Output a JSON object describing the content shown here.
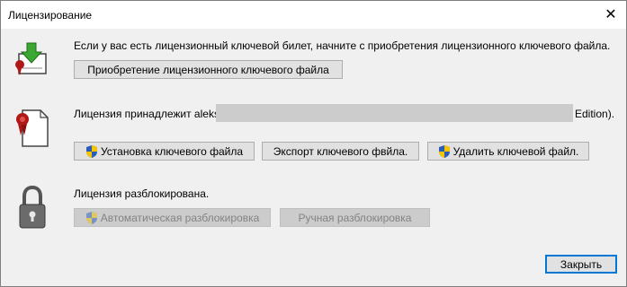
{
  "window": {
    "title": "Лицензирование",
    "close_glyph": "✕"
  },
  "purchase": {
    "text": "Если у вас есть  лицензионный ключевой билет, начните с приобретения лицензионного ключевого файла.",
    "button": "Приобретение лицензионного ключевого файла",
    "icon": "download-certificate-icon"
  },
  "license": {
    "text_prefix": "Лицензия принадлежит aleks",
    "text_suffix": "Edition).",
    "icon": "certificate-document-icon",
    "buttons": {
      "install": "Установка ключевого файла",
      "export": "Экспорт ключевого фвйла.",
      "delete": "Удалить ключевой файл."
    }
  },
  "unlock": {
    "text": "Лицензия разблокирована.",
    "icon": "padlock-icon",
    "buttons": {
      "auto": "Автоматическая разблокировка",
      "manual": "Ручная разблокировка"
    }
  },
  "footer": {
    "close_button": "Закрыть"
  },
  "colors": {
    "accent": "#0078d7",
    "shield_blue": "#2b5cb8",
    "shield_yellow": "#f5c400",
    "green_arrow": "#3aa832",
    "ribbon_red": "#b01818"
  }
}
